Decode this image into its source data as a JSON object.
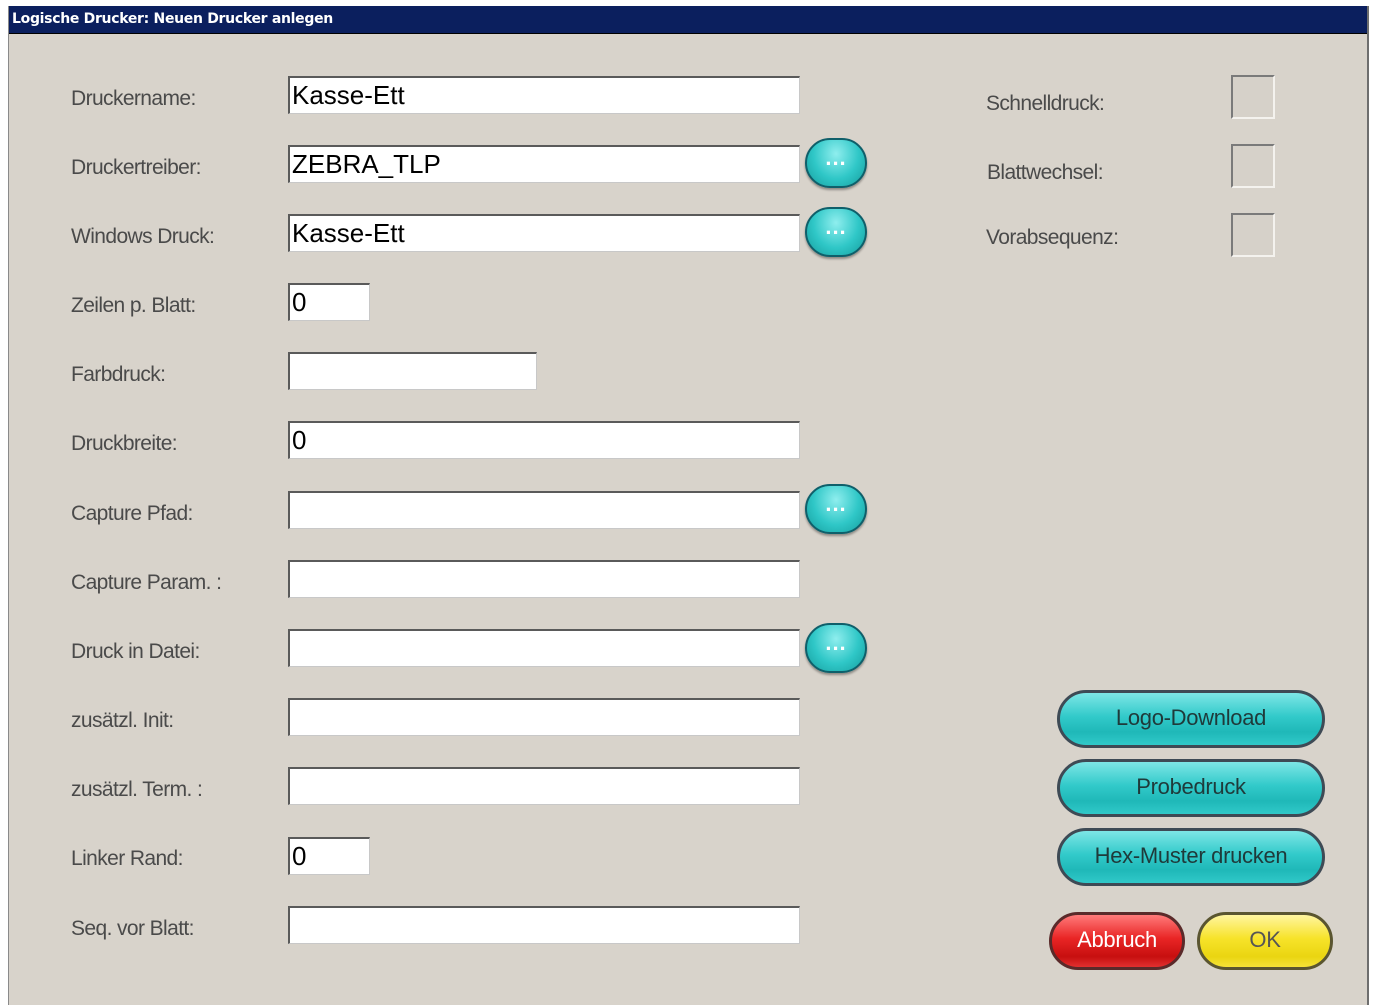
{
  "window": {
    "title": "Logische Drucker: Neuen Drucker anlegen"
  },
  "form": {
    "druckername": {
      "label": "Druckername:",
      "value": "Kasse-Ett"
    },
    "druckertreiber": {
      "label": "Druckertreiber:",
      "value": "ZEBRA_TLP"
    },
    "windows_druck": {
      "label": "Windows Druck:",
      "value": "Kasse-Ett"
    },
    "zeilen": {
      "label": "Zeilen p. Blatt:",
      "value": "0"
    },
    "farbdruck": {
      "label": "Farbdruck:",
      "value": ""
    },
    "druckbreite": {
      "label": "Druckbreite:",
      "value": "0"
    },
    "capture_pfad": {
      "label": "Capture Pfad:",
      "value": ""
    },
    "capture_param": {
      "label": "Capture Param. :",
      "value": ""
    },
    "druck_datei": {
      "label": "Druck in Datei:",
      "value": ""
    },
    "zus_init": {
      "label": "zusätzl. Init:",
      "value": ""
    },
    "zus_term": {
      "label": "zusätzl. Term. :",
      "value": ""
    },
    "linker_rand": {
      "label": "Linker Rand:",
      "value": "0"
    },
    "seq_vor_blatt": {
      "label": "Seq. vor Blatt:",
      "value": ""
    }
  },
  "browse_button_label": "...",
  "options": {
    "schnelldruck": {
      "label": "Schnelldruck:",
      "checked": false
    },
    "blattwechsel": {
      "label": "Blattwechsel:",
      "checked": false
    },
    "vorabsequenz": {
      "label": "Vorabsequenz:",
      "checked": false
    }
  },
  "buttons": {
    "logo_download": "Logo-Download",
    "probedruck": "Probedruck",
    "hex_muster": "Hex-Muster drucken",
    "abbruch": "Abbruch",
    "ok": "OK"
  },
  "colors": {
    "title_bar": "#0b1f5e",
    "background": "#d8d3cb",
    "accent_cyan": "#32caca",
    "cancel_red": "#e92525",
    "ok_yellow": "#f7e32a"
  }
}
